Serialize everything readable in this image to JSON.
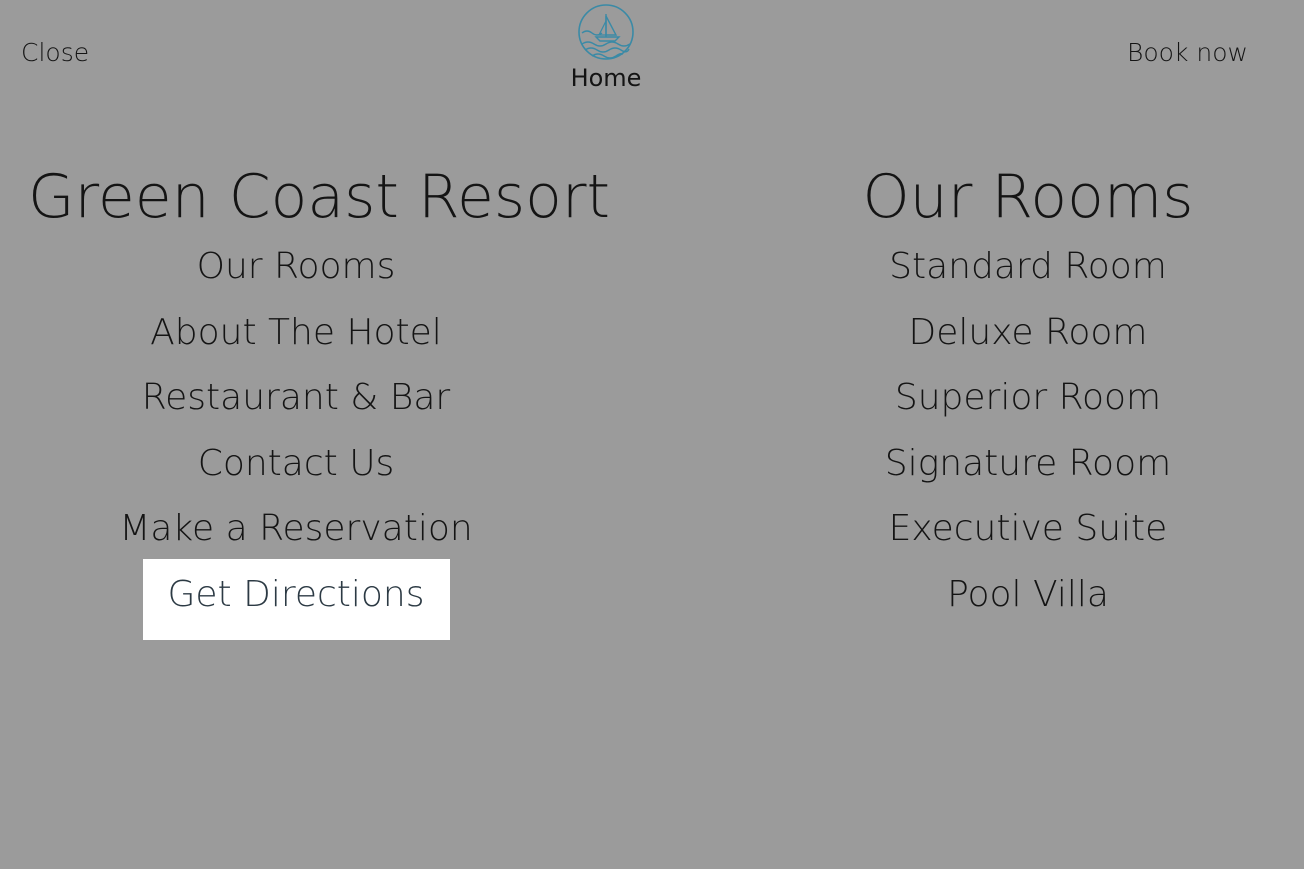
{
  "topbar": {
    "close_label": "Close",
    "home_label": "Home",
    "book_label": "Book now"
  },
  "icons": {
    "logo": "sailboat-waves-logo-icon"
  },
  "colors": {
    "overlay_background": "#9b9b9b",
    "logo_teal": "#3a8aa6",
    "highlight_background": "#ffffff"
  },
  "resort_menu": {
    "heading": "Green Coast Resort",
    "items": [
      {
        "label": "Our Rooms"
      },
      {
        "label": "About The Hotel"
      },
      {
        "label": "Restaurant & Bar"
      },
      {
        "label": "Contact Us"
      },
      {
        "label": "Make a Reservation"
      },
      {
        "label": "Get Directions",
        "highlighted": true
      }
    ]
  },
  "rooms_menu": {
    "heading": "Our Rooms",
    "items": [
      {
        "label": "Standard Room"
      },
      {
        "label": "Deluxe Room"
      },
      {
        "label": "Superior Room"
      },
      {
        "label": "Signature Room"
      },
      {
        "label": "Executive Suite"
      },
      {
        "label": "Pool Villa"
      }
    ]
  }
}
